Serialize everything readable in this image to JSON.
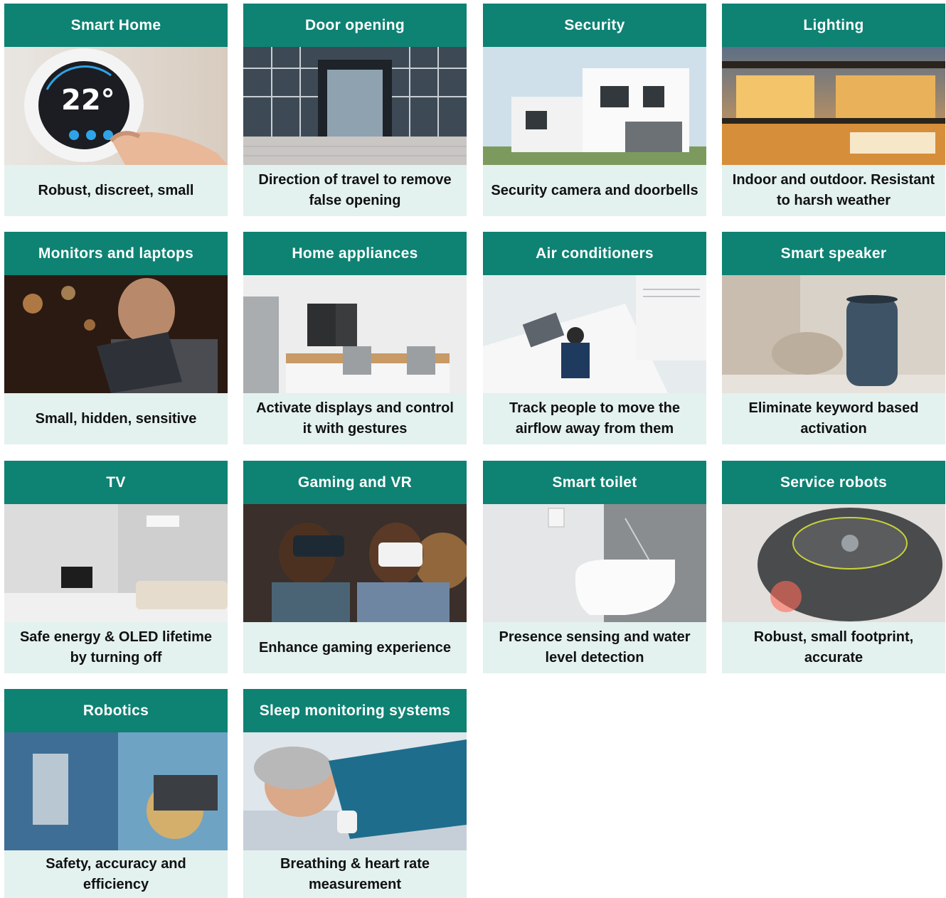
{
  "cards": [
    {
      "title": "Smart Home",
      "caption": "Robust, discreet, small",
      "image": "thermostat-photo",
      "display": "22°"
    },
    {
      "title": "Door opening",
      "caption": "Direction of travel to remove false opening",
      "image": "glass-entrance-photo"
    },
    {
      "title": "Security",
      "caption": "Security camera and doorbells",
      "image": "modern-house-photo"
    },
    {
      "title": "Lighting",
      "caption": "Indoor and outdoor. Resistant to harsh weather",
      "image": "lit-villa-photo"
    },
    {
      "title": "Monitors and laptops",
      "caption": "Small, hidden, sensitive",
      "image": "man-with-tablet-photo"
    },
    {
      "title": "Home appliances",
      "caption": "Activate displays and control it with gestures",
      "image": "kitchen-photo"
    },
    {
      "title": "Air conditioners",
      "caption": "Track people to move the airflow away from them",
      "image": "office-ac-photo"
    },
    {
      "title": "Smart speaker",
      "caption": "Eliminate keyword based activation",
      "image": "smart-speaker-photo"
    },
    {
      "title": "TV",
      "caption": "Safe energy & OLED lifetime by turning off",
      "image": "living-room-tv-photo"
    },
    {
      "title": "Gaming and VR",
      "caption": "Enhance gaming experience",
      "image": "vr-headsets-photo"
    },
    {
      "title": "Smart toilet",
      "caption": "Presence sensing and water level detection",
      "image": "smart-toilet-photo"
    },
    {
      "title": "Service robots",
      "caption": "Robust, small footprint, accurate",
      "image": "robot-vacuum-photo"
    },
    {
      "title": "Robotics",
      "caption": "Safety, accuracy and efficiency",
      "image": "industrial-robot-photo"
    },
    {
      "title": "Sleep monitoring systems",
      "caption": "Breathing & heart rate measurement",
      "image": "sleeping-woman-photo"
    }
  ],
  "colors": {
    "header": "#0e8273",
    "caption_bg": "#e3f1ef",
    "text": "#111111"
  }
}
